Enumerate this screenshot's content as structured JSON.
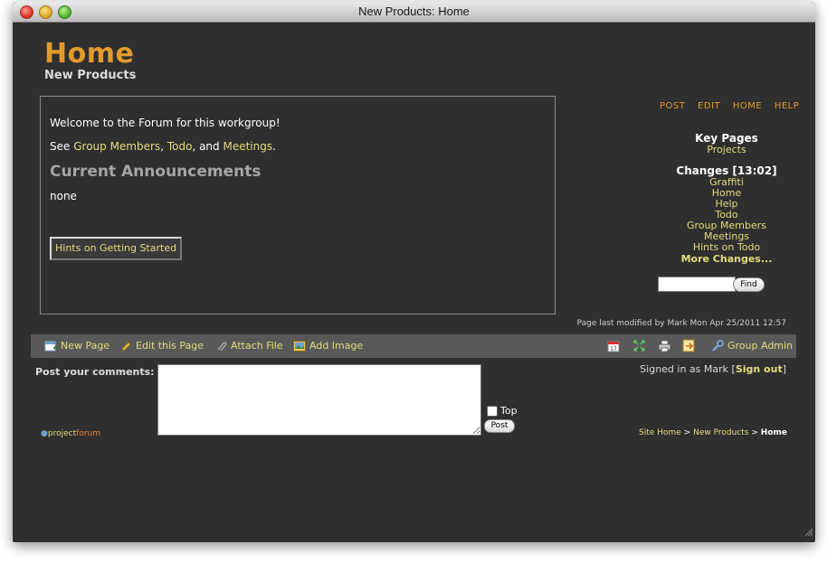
{
  "window": {
    "title": "New Products: Home"
  },
  "page": {
    "title": "Home",
    "subtitle": "New Products"
  },
  "content": {
    "welcome": "Welcome to the Forum for this workgroup!",
    "see_prefix": "See",
    "links": [
      "Group Members",
      "Todo",
      "Meetings"
    ],
    "sep_comma": ",",
    "sep_and": ", and",
    "period": ".",
    "announcements_heading": "Current Announcements",
    "announcements_text": "none",
    "hints_button": "Hints on Getting Started"
  },
  "top_actions": [
    "POST",
    "EDIT",
    "HOME",
    "HELP"
  ],
  "sidebar": {
    "key_pages_heading": "Key Pages",
    "key_pages": [
      "Projects"
    ],
    "changes_heading": "Changes [13:02]",
    "changes": [
      "Graffiti",
      "Home",
      "Help",
      "Todo",
      "Group Members",
      "Meetings",
      "Hints on Todo"
    ],
    "more_changes": "More Changes...",
    "find_button": "Find"
  },
  "modified_text": "Page last modified by Mark Mon Apr 25/2011 12:57",
  "toolbar": {
    "new_page": "New Page",
    "edit_page": "Edit this Page",
    "attach_file": "Attach File",
    "add_image": "Add Image",
    "group_admin": "Group Admin"
  },
  "comments": {
    "label": "Post your comments:",
    "top_label": "Top",
    "post_button": "Post"
  },
  "signed_in": {
    "prefix": "Signed in as Mark [",
    "signout": "Sign out",
    "suffix": "]"
  },
  "logo": {
    "part1": "project",
    "part2": "forum"
  },
  "breadcrumb": {
    "items": [
      "Site Home",
      "New Products"
    ],
    "separator": ">",
    "current": "Home"
  },
  "colors": {
    "accent_orange": "#e39a2d",
    "link_yellow": "#e2dd7c",
    "background": "#2f2f2f",
    "toolbar_bg": "#595959"
  }
}
